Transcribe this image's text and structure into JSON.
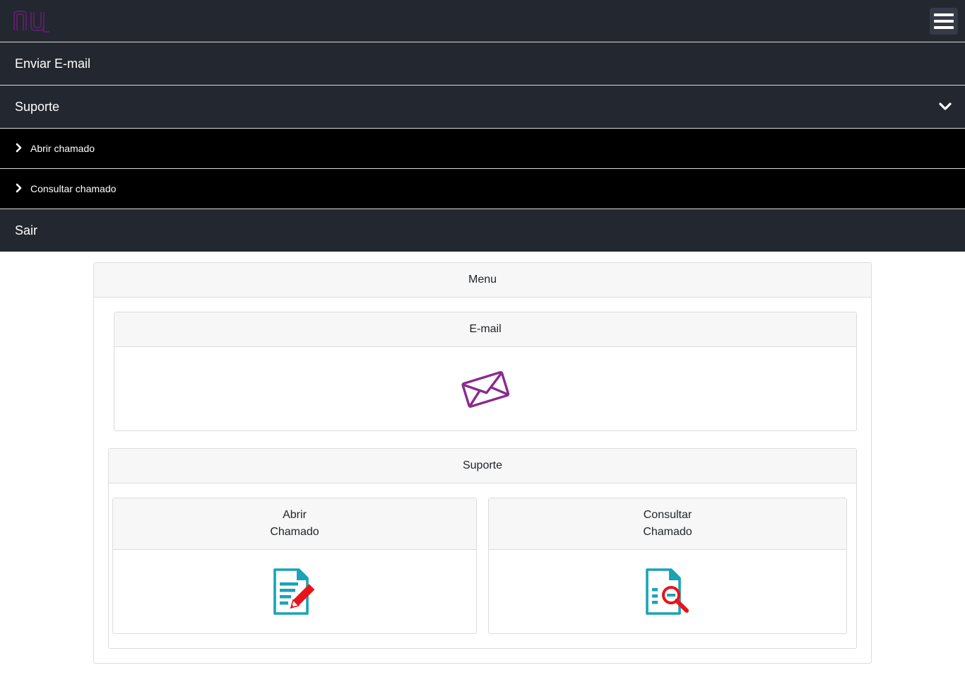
{
  "header": {
    "logo_icon": "nu-logo",
    "menu_icon": "hamburger-icon",
    "logo_color": "#7b1f7f"
  },
  "nav": {
    "email": "Enviar E-mail",
    "suporte": "Suporte",
    "suporte_icon": "chevron-down-icon",
    "sub_items": [
      {
        "label": "Abrir chamado",
        "icon": "chevron-right-icon"
      },
      {
        "label": "Consultar chamado",
        "icon": "chevron-right-icon"
      }
    ],
    "sair": "Sair"
  },
  "menu": {
    "title": "Menu",
    "email_card": {
      "title": "E-mail",
      "icon": "envelope-icon",
      "icon_color": "#8a2a8f"
    },
    "suporte_card": {
      "title": "Suporte",
      "abrir": {
        "line1": "Abrir",
        "line2": "Chamado",
        "icon": "document-edit-icon"
      },
      "consultar": {
        "line1": "Consultar",
        "line2": "Chamado",
        "icon": "document-search-icon"
      }
    }
  },
  "colors": {
    "nav_bg": "#23272f",
    "sub_bg": "#000000",
    "doc_teal": "#1aa3b5",
    "accent_red": "#e8141b"
  }
}
